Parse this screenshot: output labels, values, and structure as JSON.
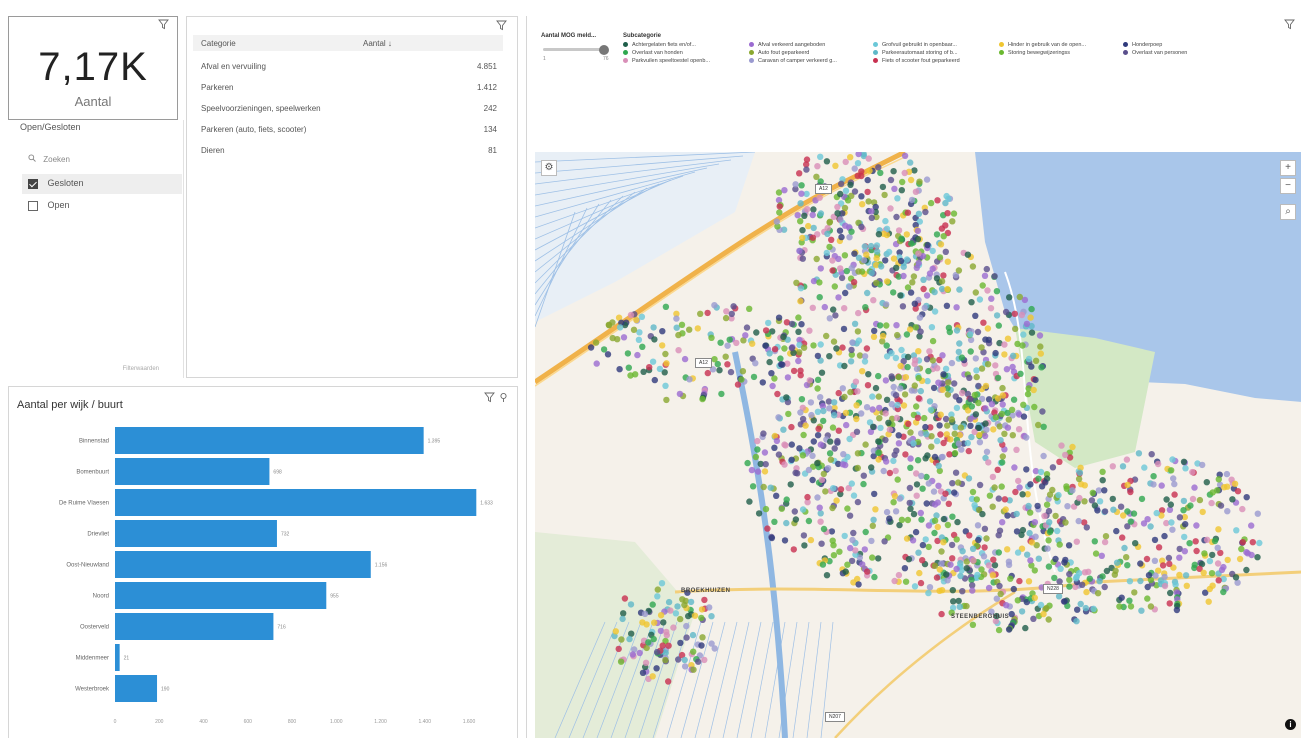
{
  "kpi": {
    "value": "7,17K",
    "label": "Aantal"
  },
  "status_filter": {
    "title": "Open/Gesloten",
    "search_placeholder": "Zoeken",
    "options": [
      {
        "label": "Gesloten",
        "checked": true
      },
      {
        "label": "Open",
        "checked": false
      }
    ],
    "footer": "Filterwaarden"
  },
  "category_table": {
    "headers": {
      "category": "Categorie",
      "count": "Aantal ↓"
    },
    "rows": [
      {
        "category": "Afval en vervuiling",
        "count": "4.851"
      },
      {
        "category": "Parkeren",
        "count": "1.412"
      },
      {
        "category": "Speelvoorzieningen, speelwerken",
        "count": "242"
      },
      {
        "category": "Parkeren (auto, fiets, scooter)",
        "count": "134"
      },
      {
        "category": "Dieren",
        "count": "81"
      }
    ]
  },
  "bar_panel": {
    "title": "Aantal per wijk / buurt"
  },
  "chart_data": {
    "type": "bar",
    "orientation": "horizontal",
    "title": "Aantal per wijk / buurt",
    "categories": [
      "Binnenstad",
      "Bomenbuurt",
      "De Ruime Vlaesen",
      "Drievliet",
      "Oost-Nieuwland",
      "Noord",
      "Oosterveld",
      "Middenmeer",
      "Westerbroek"
    ],
    "values": [
      1395,
      698,
      1633,
      732,
      1156,
      955,
      716,
      21,
      190
    ],
    "data_labels": [
      "1.395",
      "698",
      "1.633",
      "732",
      "1.156",
      "955",
      "716",
      "21",
      "190"
    ],
    "xlim": [
      0,
      1600
    ],
    "x_ticks": [
      "0",
      "200",
      "400",
      "600",
      "800",
      "1.000",
      "1.200",
      "1.400",
      "1.600"
    ],
    "color": "#2c8fd6",
    "grid": false
  },
  "map": {
    "slider_title": "Aantal MOG meld...",
    "slider_min": "1",
    "slider_max": "76",
    "legend_title": "Subcategorie",
    "legend": [
      {
        "label": "Achtergelaten fiets en/of...",
        "color": "#1f5e4a"
      },
      {
        "label": "Afval verkeerd aangeboden",
        "color": "#9b6bd1"
      },
      {
        "label": "Grofvuil gebruikt in openbaar...",
        "color": "#6bc8d8"
      },
      {
        "label": "Hinder in gebruik van de open...",
        "color": "#f0c630"
      },
      {
        "label": "Honderpoep",
        "color": "#2f3a7c"
      },
      {
        "label": "Overlast van honden",
        "color": "#2fa84f"
      },
      {
        "label": "Auto fout geparkeerd",
        "color": "#8aa830"
      },
      {
        "label": "Parkeerautomaat storing of b...",
        "color": "#5fb8c8"
      },
      {
        "label": "Storing bewegwijzeringss",
        "color": "#6ab82f"
      },
      {
        "label": "Overlast van personen",
        "color": "#5a4f8c"
      },
      {
        "label": "Parkvuilen speeltoestel openb...",
        "color": "#d98fb8"
      },
      {
        "label": "Caravan of camper verkeerd g...",
        "color": "#9a9ad0"
      },
      {
        "label": "Fiets of scooter fout geparkeerd",
        "color": "#c83050"
      }
    ],
    "place_labels": [
      "BROEKHUIZEN",
      "STEENBERGHUIS"
    ],
    "road_labels": [
      "A12",
      "N228",
      "A12",
      "N207"
    ],
    "zoom_in": "+",
    "zoom_out": "−",
    "search": "⌕",
    "info": "i"
  }
}
